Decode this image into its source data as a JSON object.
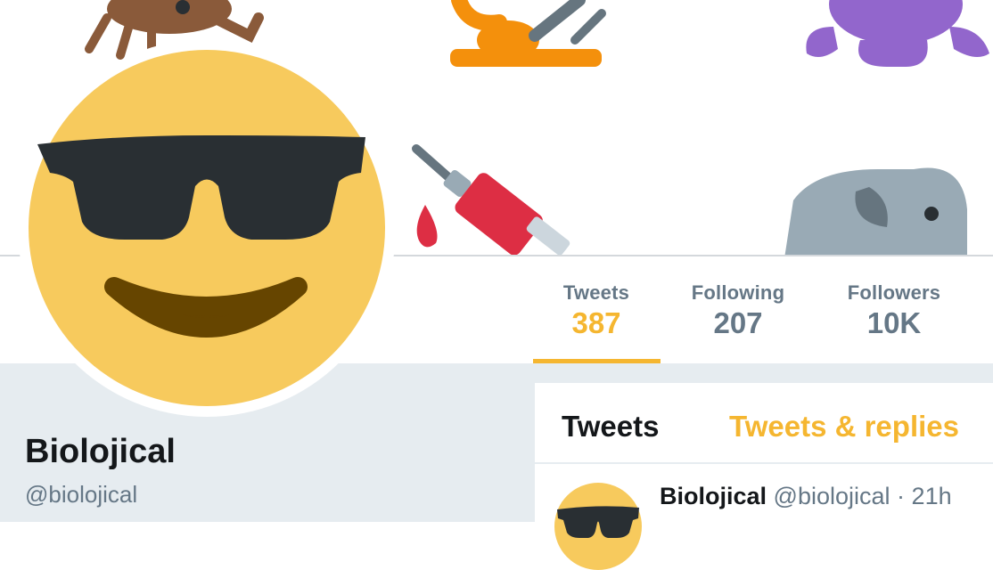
{
  "profile": {
    "name": "Biolojical",
    "handle": "@biolojical"
  },
  "stats": [
    {
      "label": "Tweets",
      "value": "387",
      "active": true
    },
    {
      "label": "Following",
      "value": "207",
      "active": false
    },
    {
      "label": "Followers",
      "value": "10K",
      "active": false
    }
  ],
  "tabs": {
    "tweets": "Tweets",
    "replies": "Tweets & replies"
  },
  "tweet": {
    "author": "Biolojical",
    "handle": "@biolojical",
    "separator": "·",
    "time": "21h"
  },
  "banner": {
    "emojis": [
      "scorpion-emoji",
      "microscope-emoji",
      "octopus-emoji",
      "syringe-emoji",
      "elephant-emoji"
    ]
  },
  "colors": {
    "accent": "#f5b630",
    "muted": "#657786",
    "text": "#14171a",
    "background": "#e6ecf0"
  }
}
